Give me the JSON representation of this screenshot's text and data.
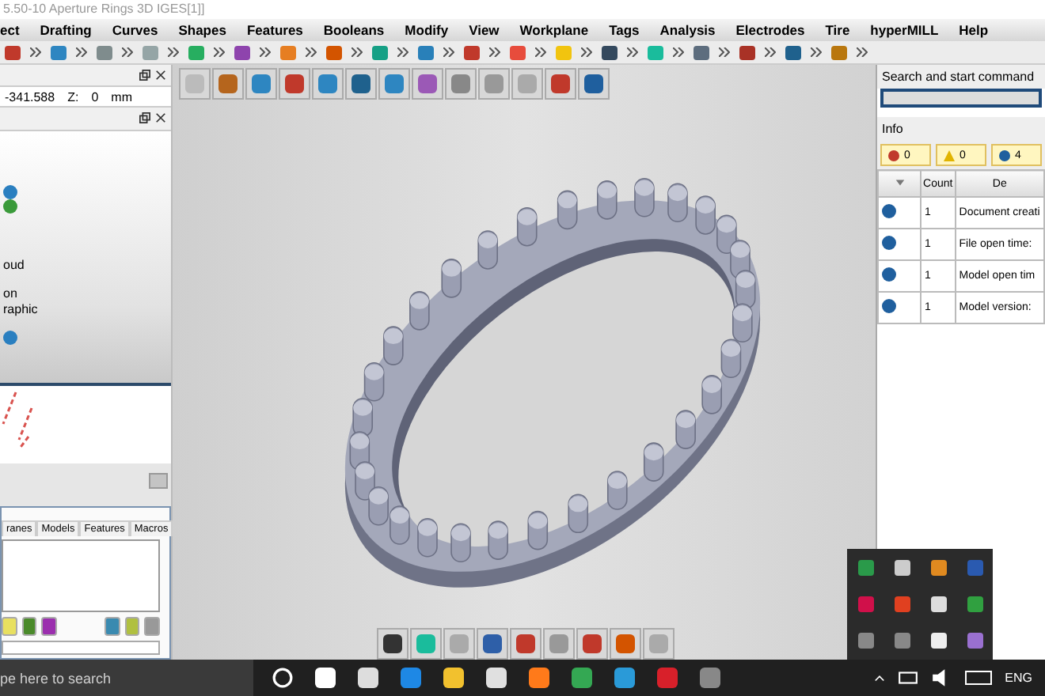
{
  "window": {
    "title": "5.50-10 Aperture Rings 3D IGES[1]]"
  },
  "menu": [
    "ect",
    "Drafting",
    "Curves",
    "Shapes",
    "Features",
    "Booleans",
    "Modify",
    "View",
    "Workplane",
    "Tags",
    "Analysis",
    "Electrodes",
    "Tire",
    "hyperMILL",
    "Help"
  ],
  "left_panel": {
    "coordinates": {
      "value": "-341.588",
      "z_label": "Z:",
      "z_value": "0",
      "unit": "mm"
    },
    "tree_labels": [
      "oud",
      "on",
      "raphic"
    ],
    "tabs": [
      "ranes",
      "Models",
      "Features",
      "Macros"
    ]
  },
  "right_panel": {
    "search": {
      "label": "Search and start command"
    },
    "info": {
      "title": "Info",
      "filters": [
        {
          "kind": "error",
          "count": "0"
        },
        {
          "kind": "warning",
          "count": "0"
        },
        {
          "kind": "info",
          "count": "4"
        }
      ],
      "columns": [
        "Count",
        "De"
      ],
      "rows": [
        {
          "count": "1",
          "description": "Document creati"
        },
        {
          "count": "1",
          "description": "File open time:"
        },
        {
          "count": "1",
          "description": "Model open tim"
        },
        {
          "count": "1",
          "description": "Model version:"
        }
      ]
    }
  },
  "taskbar": {
    "search": {
      "placeholder": "pe here to search"
    },
    "language": "ENG"
  }
}
